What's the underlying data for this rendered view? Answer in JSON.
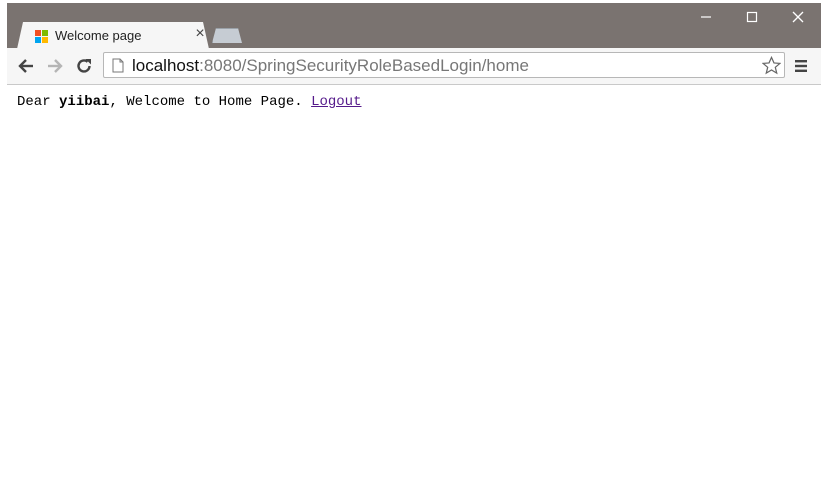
{
  "browser": {
    "tab": {
      "title": "Welcome page",
      "close_glyph": "×"
    },
    "window_controls": {
      "minimize": "—",
      "maximize": "☐",
      "close": "✕"
    },
    "address": {
      "host": "localhost",
      "rest": ":8080/SpringSecurityRoleBasedLogin/home"
    }
  },
  "page": {
    "greeting_prefix": "Dear ",
    "username": "yiibai",
    "greeting_suffix": ", Welcome to Home Page. ",
    "logout_label": "Logout"
  },
  "colors": {
    "frame": "#7a7370",
    "link_visited": "#551a8b",
    "favicon": [
      "#f25022",
      "#7fba00",
      "#00a4ef",
      "#ffb900"
    ]
  },
  "icons": {
    "back": "arrow-left-icon",
    "forward": "arrow-right-icon",
    "reload": "reload-icon",
    "page": "page-icon",
    "bookmark": "star-icon",
    "menu": "hamburger-menu-icon"
  }
}
